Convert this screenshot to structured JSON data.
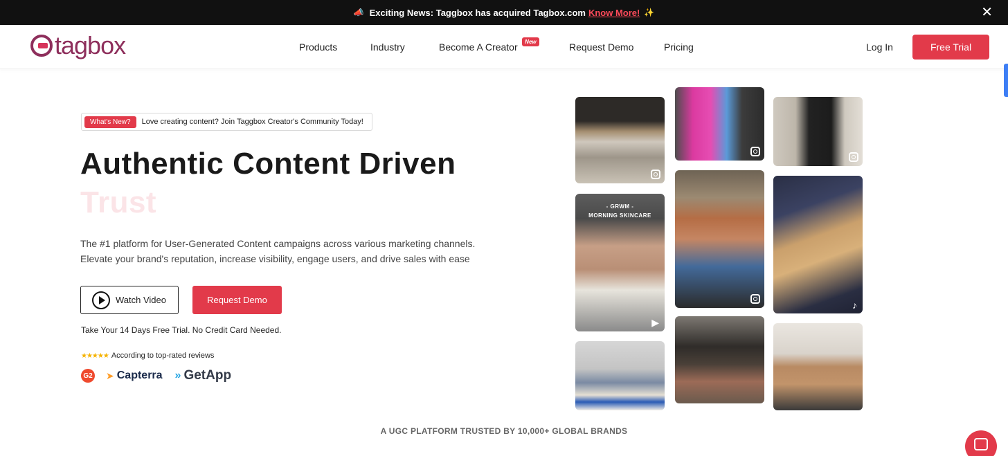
{
  "announcement": {
    "icon": "megaphone-icon",
    "text": "Exciting News: Taggbox has acquired Tagbox.com",
    "link": "Know More!",
    "sparkle": "✨",
    "close": "✕"
  },
  "nav": {
    "logo_text": "tagbox",
    "items": [
      {
        "label": "Products"
      },
      {
        "label": "Industry"
      },
      {
        "label": "Become A Creator",
        "badge": "New"
      },
      {
        "label": "Request Demo"
      },
      {
        "label": "Pricing"
      }
    ],
    "login": "Log In",
    "cta": "Free Trial"
  },
  "hero": {
    "whats_new_pill": "What's New?",
    "whats_new_text": "Love creating content? Join Taggbox Creator's Community Today!",
    "headline_line1": "Authentic Content Driven",
    "headline_line2": "Trust",
    "description": "The #1 platform for User-Generated Content campaigns across various marketing channels. Elevate your brand's reputation, increase visibility, engage users, and drive sales with ease",
    "watch_video": "Watch Video",
    "request_demo": "Request Demo",
    "trial_note": "Take Your 14 Days Free Trial. No Credit Card Needed.",
    "reviews_text": "According to top-rated reviews",
    "stars": "★★★★★",
    "review_sites": {
      "g2": "G2",
      "capterra": "Capterra",
      "getapp": "GetApp"
    }
  },
  "grid": {
    "tiles": [
      {
        "platform": "instagram-icon"
      },
      {
        "platform": "instagram-icon"
      },
      {
        "platform": "instagram-icon"
      },
      {
        "platform": "shorts-icon",
        "overlay_line1": "- GRWM -",
        "overlay_line2": "MORNING SKINCARE"
      },
      {
        "platform": "reels-icon"
      },
      {
        "platform": "tiktok-icon"
      },
      {
        "platform": "none"
      },
      {
        "platform": "none"
      },
      {
        "platform": "none"
      }
    ]
  },
  "trusted_text": "A UGC PLATFORM TRUSTED BY 10,000+ GLOBAL BRANDS",
  "colors": {
    "brand_red": "#e23a4a",
    "logo_purple": "#8e2f5c",
    "announce_bg": "#111111"
  }
}
